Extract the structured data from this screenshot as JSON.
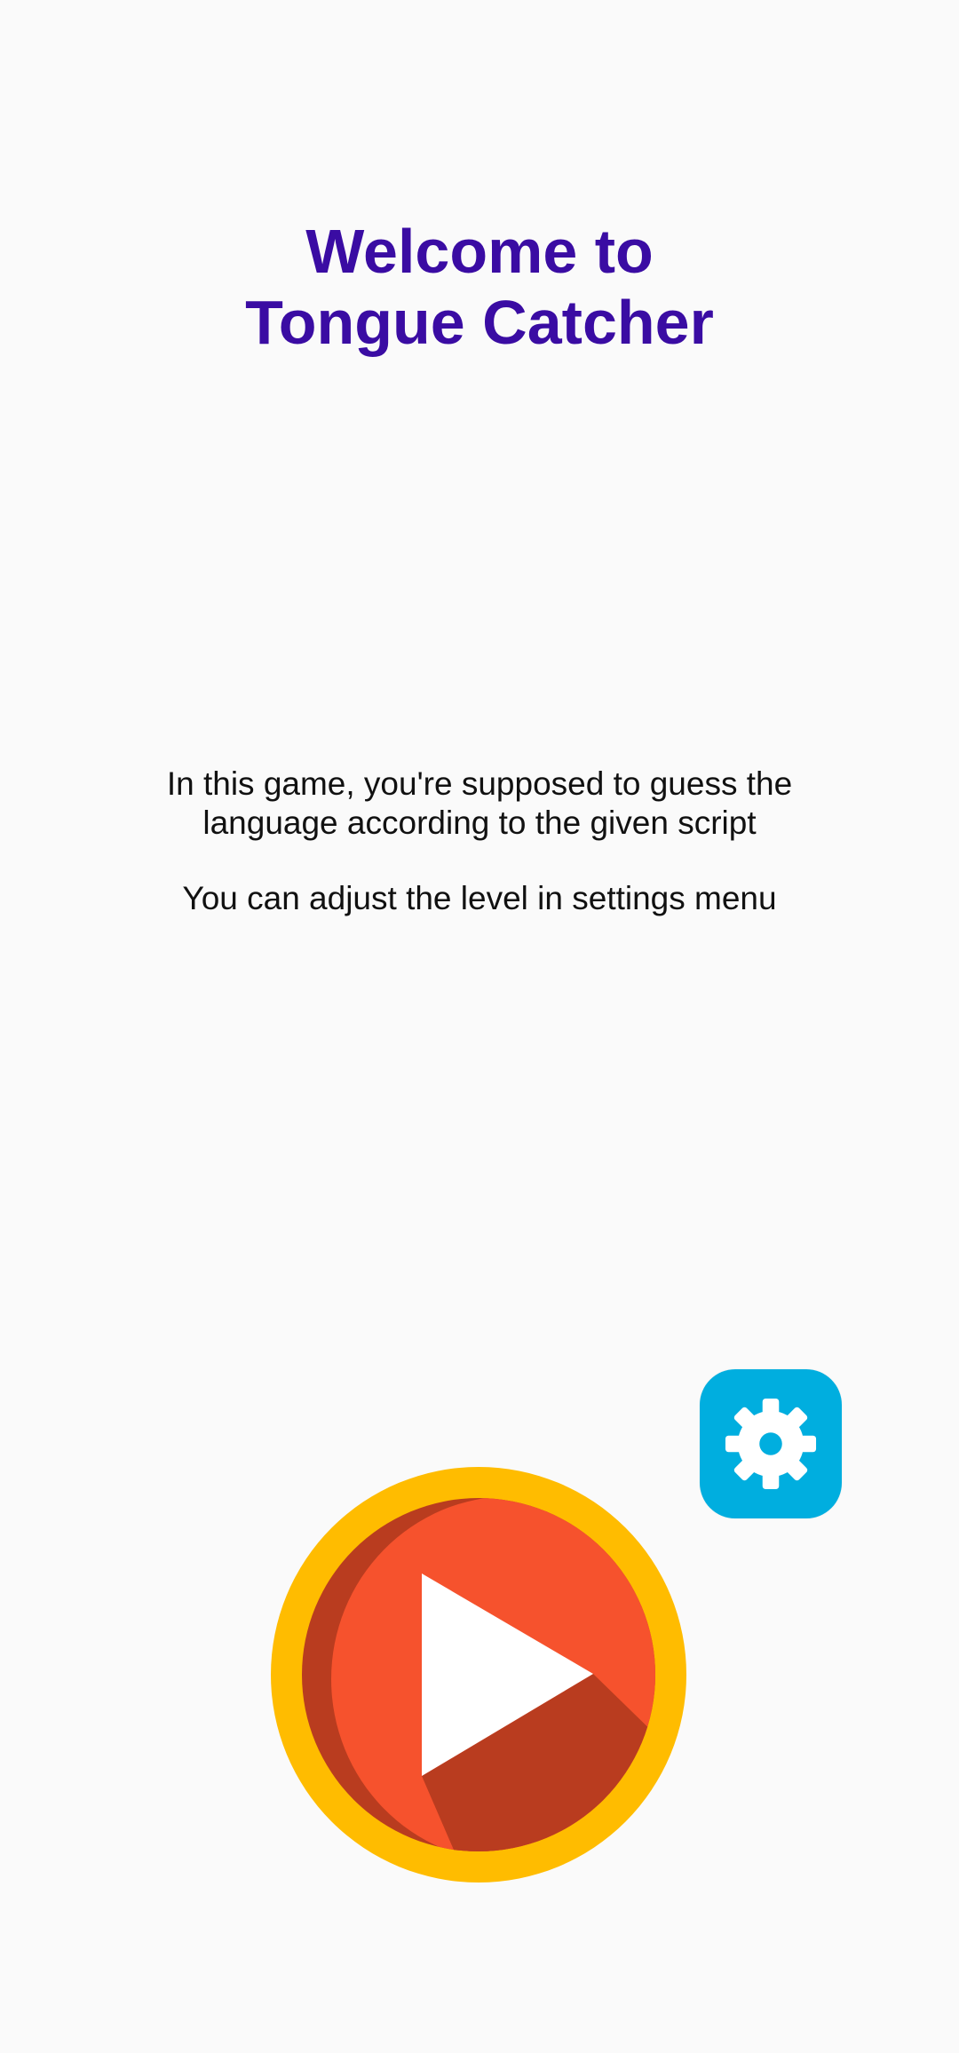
{
  "header": {
    "title_line1": "Welcome to",
    "title_line2": "Tongue Catcher"
  },
  "description": {
    "line1": "In this game, you're supposed to guess the",
    "line2": "language according to the given script",
    "line3": "You can adjust the level in settings menu"
  },
  "controls": {
    "settings_icon": "gear-icon",
    "play_icon": "play-icon"
  },
  "colors": {
    "background": "#fafafa",
    "title": "#3a0ca3",
    "settings_bg": "#00aedf",
    "play_ring": "#ffbc00",
    "play_dark": "#b93c1f",
    "play_face": "#f6522d",
    "play_triangle": "#ffffff"
  }
}
